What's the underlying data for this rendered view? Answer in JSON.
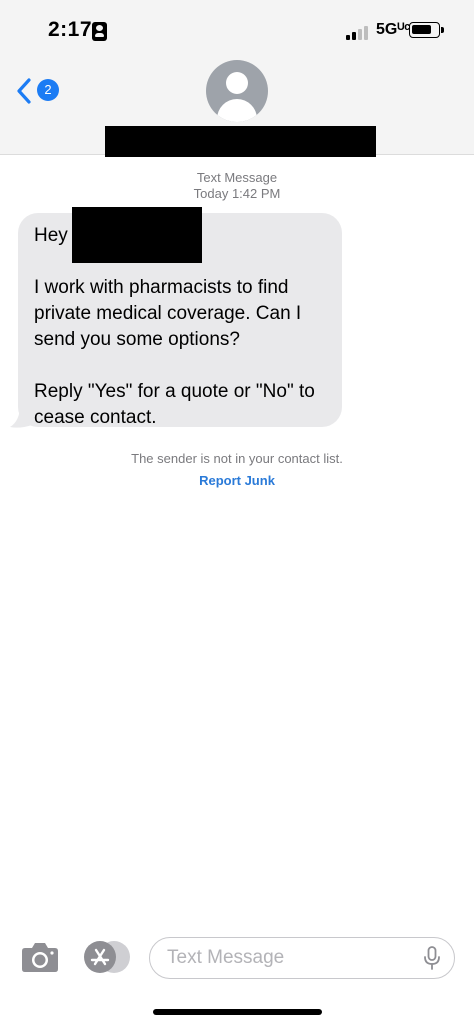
{
  "status_bar": {
    "time": "2:17",
    "network": "5Gᵁᶜ",
    "battery_level": 0.8
  },
  "header": {
    "back_badge_count": "2",
    "back_icon": "chevron-left-icon",
    "avatar_icon": "person-icon"
  },
  "conversation": {
    "service_label": "Text Message",
    "timestamp": "Today 1:42 PM",
    "message": {
      "greeting": "Hey",
      "paragraph_1": "I work with pharmacists to find private medical coverage. Can I send you some options?",
      "paragraph_2": "Reply \"Yes\" for a quote or \"No\" to cease contact."
    },
    "sender_note": "The sender is not in your contact list.",
    "report_junk_label": "Report Junk"
  },
  "input_bar": {
    "camera_icon": "camera-icon",
    "apps_icon": "app-store-icon",
    "placeholder": "Text Message",
    "mic_icon": "microphone-icon"
  },
  "colors": {
    "accent": "#1c7cf4",
    "link": "#2a7ad8",
    "bubble": "#e9e9eb",
    "header_bg": "#f4f4f4"
  }
}
